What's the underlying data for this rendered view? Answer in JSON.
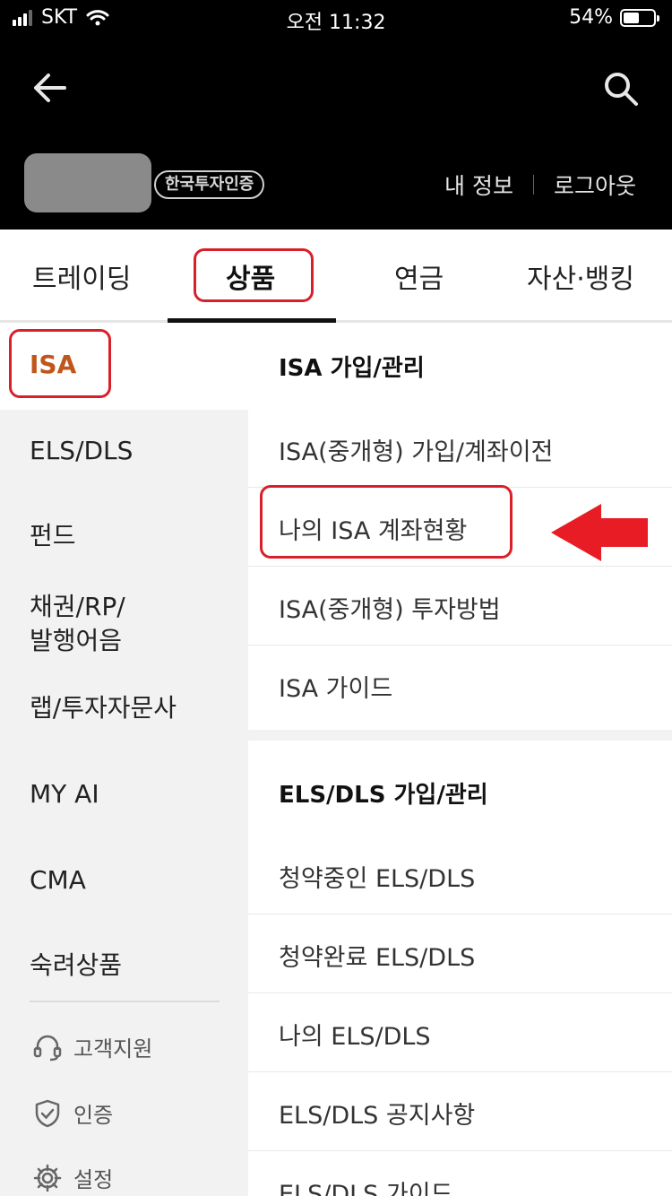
{
  "status_bar": {
    "carrier": "SKT",
    "time": "오전 11:32",
    "battery": "54%",
    "battery_level": 0.54
  },
  "header": {
    "back_icon": "arrow-left-icon",
    "search_icon": "search-icon",
    "cert_badge": "한국투자인증",
    "my_info": "내 정보",
    "logout": "로그아웃"
  },
  "tabs": [
    {
      "label": "트레이딩"
    },
    {
      "label": "상품",
      "active": true
    },
    {
      "label": "연금"
    },
    {
      "label": "자산·뱅킹"
    }
  ],
  "side_menu": {
    "items": [
      {
        "label": "ISA",
        "active": true
      },
      {
        "label": "ELS/DLS"
      },
      {
        "label": "펀드"
      },
      {
        "label": "채권/RP/\n발행어음"
      },
      {
        "label": "랩/투자자문사"
      },
      {
        "label": "MY AI"
      },
      {
        "label": "CMA"
      },
      {
        "label": "숙려상품"
      }
    ],
    "utilities": [
      {
        "label": "고객지원",
        "icon": "headset-icon"
      },
      {
        "label": "인증",
        "icon": "shield-check-icon"
      },
      {
        "label": "설정",
        "icon": "gear-icon"
      }
    ]
  },
  "sections": [
    {
      "title": "ISA 가입/관리",
      "items": [
        "ISA(중개형) 가입/계좌이전",
        "나의 ISA 계좌현황",
        "ISA(중개형) 투자방법",
        "ISA 가이드"
      ]
    },
    {
      "title": "ELS/DLS 가입/관리",
      "items": [
        "청약중인 ELS/DLS",
        "청약완료 ELS/DLS",
        "나의 ELS/DLS",
        "ELS/DLS 공지사항",
        "ELS/DLS 가이드"
      ]
    }
  ],
  "colors": {
    "annotation": "#d9202a",
    "active_menu": "#c0561c",
    "header_bg": "#000000"
  }
}
